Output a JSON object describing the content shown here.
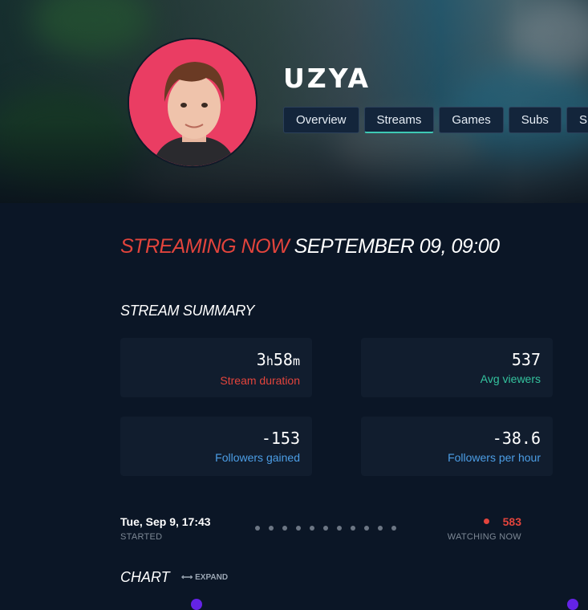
{
  "channel": {
    "name": "UZYA"
  },
  "tabs": [
    {
      "label": "Overview",
      "active": false
    },
    {
      "label": "Streams",
      "active": true
    },
    {
      "label": "Games",
      "active": false
    },
    {
      "label": "Subs",
      "active": false
    },
    {
      "label": "S",
      "active": false
    }
  ],
  "stream": {
    "status": "STREAMING NOW",
    "datetime": "SEPTEMBER 09, 09:00"
  },
  "summary": {
    "title": "STREAM SUMMARY",
    "duration": {
      "hours": "3",
      "h": "h",
      "minutes": "58",
      "m": "m",
      "label": "Stream duration"
    },
    "avg_viewers": {
      "value": "537",
      "label": "Avg viewers"
    },
    "followers_gained": {
      "value": "-153",
      "label": "Followers gained"
    },
    "followers_per_hour": {
      "value": "-38.6",
      "label": "Followers per hour"
    }
  },
  "timeline": {
    "started_time": "Tue, Sep 9, 17:43",
    "started_label": "STARTED",
    "watching_count": "583",
    "watching_label": "WATCHING NOW"
  },
  "chart": {
    "title": "CHART",
    "expand_label": "⟷ EXPAND"
  },
  "colors": {
    "live": "#e2443c",
    "green": "#34c39e",
    "blue": "#4c9ee6",
    "accent": "#3ec9b4",
    "marker": "#6423e6"
  },
  "icons": {
    "live": "live-dot-icon",
    "expand": "expand-arrows-icon"
  }
}
